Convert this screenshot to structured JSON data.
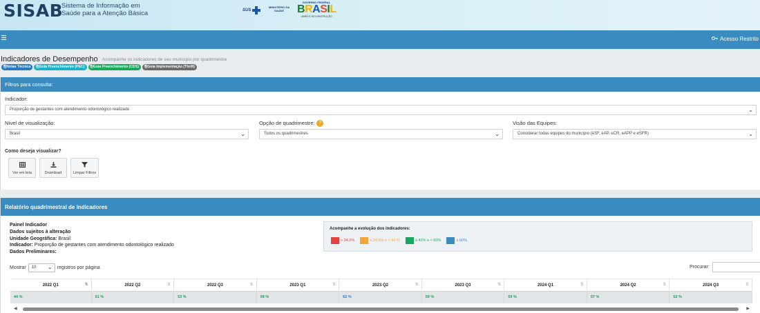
{
  "header": {
    "brand": "SISAB",
    "brand_subtitle_1": "Sistema de Informação em",
    "brand_subtitle_2": "Saúde para a Atenção Básica",
    "sus": "SUS",
    "ministerio_1": "MINISTÉRIO DA",
    "ministerio_2": "SAÚDE",
    "gov_top": "GOVERNO FEDERAL",
    "gov_name": [
      "B",
      "R",
      "A",
      "S",
      "I",
      "L"
    ],
    "gov_bottom": "UNIÃO E RECONSTRUÇÃO"
  },
  "navbar": {
    "menu_icon": "hamburger-icon",
    "acesso": "Acesso Restrito",
    "key_icon": "key-icon"
  },
  "page": {
    "title": "Indicadores de Desempenho",
    "subtitle": "Acompanhe os indicadores de seu município por quadrimestre",
    "pills": [
      {
        "label": "Notas Técnica",
        "color": "#2a7ac0"
      },
      {
        "label": "Guia Preenchimento (PEC)",
        "color": "#1bb1c9"
      },
      {
        "label": "Guia Preenchimento (CDS)",
        "color": "#18a85c"
      },
      {
        "label": "Guia Implementação (Thrift)",
        "color": "#6b6b6b"
      }
    ]
  },
  "filters": {
    "header": "Filtros para consulta:",
    "indicador_label": "Indicador:",
    "indicador_value": "Proporção de gestantes com atendimento odontológico realizado",
    "nivel_label": "Nível de visualização:",
    "nivel_value": "Brasil",
    "quad_label": "Opção de quadrimestre:",
    "quad_value": "Todos os quadrimestres",
    "visao_label": "Visão das Equipes:",
    "visao_value": "Considerar todas equipes do município (eSF, eAP, eCR, eAPP e eSFR)",
    "como_label": "Como deseja visualizar?",
    "buttons": [
      {
        "label": "Ver em tela",
        "icon": "table-icon"
      },
      {
        "label": "Download",
        "icon": "download-icon"
      },
      {
        "label": "Limpar Filtros",
        "icon": "filter-icon"
      }
    ]
  },
  "report": {
    "header": "Relatório quadrimestral de indicadores",
    "painel": "Painel Indicador",
    "dados_alteracao": "Dados sujeitos à alteração",
    "unidade_label": "Unidade Geográfica:",
    "unidade_value": "Brasil",
    "indicador_label": "Indicador:",
    "indicador_value": "Proporção de gestantes com atendimento odontológico realizado",
    "preliminares": "Dados Preliminares:",
    "legend_title": "Acompanhe a evolução dos indicadores:",
    "legend": [
      {
        "label": "< 24,0%",
        "color": "#e0443a"
      },
      {
        "label": "≥ 24,0% e < 42 %",
        "color": "#f0a43a"
      },
      {
        "label": "≥ 42% e < 60%",
        "color": "#18a85c"
      },
      {
        "label": "≥ 60%",
        "color": "#3a8bc0"
      }
    ],
    "mostrar": "Mostrar",
    "page_size": "10",
    "registros": "registros por página",
    "procurar": "Procurar:",
    "columns": [
      "2022 Q1",
      "2022 Q2",
      "2022 Q3",
      "2023 Q1",
      "2023 Q2",
      "2023 Q3",
      "2024 Q1",
      "2024 Q2",
      "2024 Q3"
    ],
    "values": [
      "44 %",
      "51 %",
      "53 %",
      "58 %",
      "62 %",
      "59 %",
      "59 %",
      "57 %",
      "52 %"
    ],
    "value_colors": [
      "green",
      "green",
      "green",
      "green",
      "blue",
      "green",
      "green",
      "green",
      "green"
    ]
  }
}
